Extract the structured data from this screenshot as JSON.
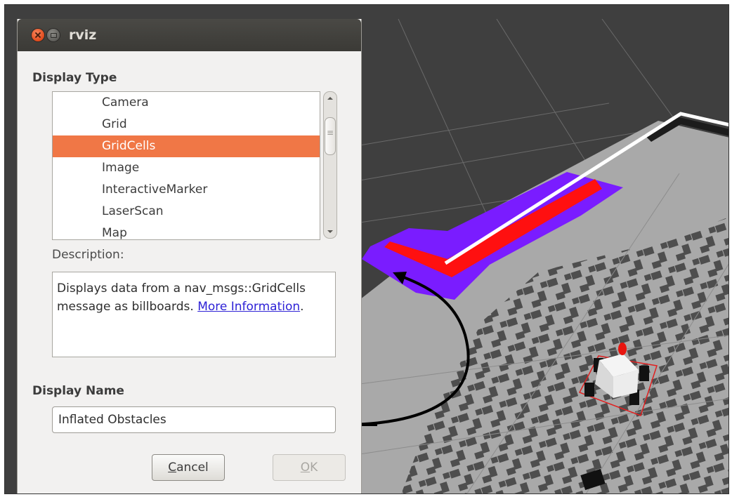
{
  "window": {
    "title": "rviz"
  },
  "display_type": {
    "heading": "Display Type",
    "items": [
      {
        "label": "Camera",
        "selected": false
      },
      {
        "label": "Grid",
        "selected": false
      },
      {
        "label": "GridCells",
        "selected": true
      },
      {
        "label": "Image",
        "selected": false
      },
      {
        "label": "InteractiveMarker",
        "selected": false
      },
      {
        "label": "LaserScan",
        "selected": false
      },
      {
        "label": "Map",
        "selected": false
      }
    ]
  },
  "description": {
    "label": "Description:",
    "text": "Displays data from a nav_msgs::GridCells message as billboards.",
    "link_text": "More Information",
    "trailing": "."
  },
  "display_name": {
    "heading": "Display Name",
    "value": "Inflated Obstacles"
  },
  "buttons": {
    "cancel_pre": "",
    "cancel_accel": "C",
    "cancel_post": "ancel",
    "ok_pre": "",
    "ok_accel": "O",
    "ok_post": "K"
  },
  "colors": {
    "selection": "#f07746",
    "inflated_cells": "#7a1cff",
    "obstacle_cells": "#ff1010",
    "path_line": "#ffffff",
    "viewport_background": "#3f3f3f",
    "map_floor": "#a9a9a9",
    "occupied_cells": "#4e4e4e"
  }
}
